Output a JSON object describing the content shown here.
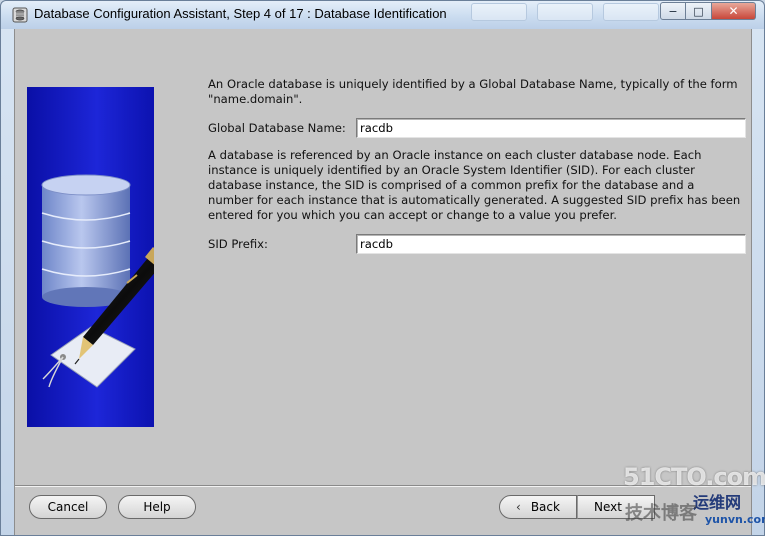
{
  "window": {
    "title": "Database Configuration Assistant, Step 4 of 17 : Database Identification",
    "controls": {
      "minimize": "−",
      "maximize": "□",
      "close": "✕"
    }
  },
  "content": {
    "intro_text": "An Oracle database is uniquely identified by a Global Database Name, typically of the form \"name.domain\".",
    "global_db_label": "Global Database Name:",
    "global_db_value": "racdb",
    "sid_text": "A database is referenced by an Oracle instance on each cluster database node. Each instance is uniquely identified by an Oracle System Identifier (SID). For each cluster database instance, the SID is comprised of a common prefix for the database and a number for each instance that is automatically generated. A suggested SID prefix has been entered for you which you can accept or change to a value you prefer.",
    "sid_label": "SID Prefix:",
    "sid_value": "racdb"
  },
  "buttons": {
    "cancel": "Cancel",
    "help": "Help",
    "back": "Back",
    "next": "Next"
  },
  "icons": {
    "app": "database-app-icon",
    "back_arrow": "chevron-left-icon"
  },
  "watermark": {
    "site1": "51CTO.com",
    "site2_cn": "技术博客",
    "site3_cn": "运维网",
    "site3_url": "yunvn.com"
  },
  "colors": {
    "banner_blue": "#1d26d8",
    "client_bg": "#c6c6c6",
    "close_red": "#c8473a"
  }
}
